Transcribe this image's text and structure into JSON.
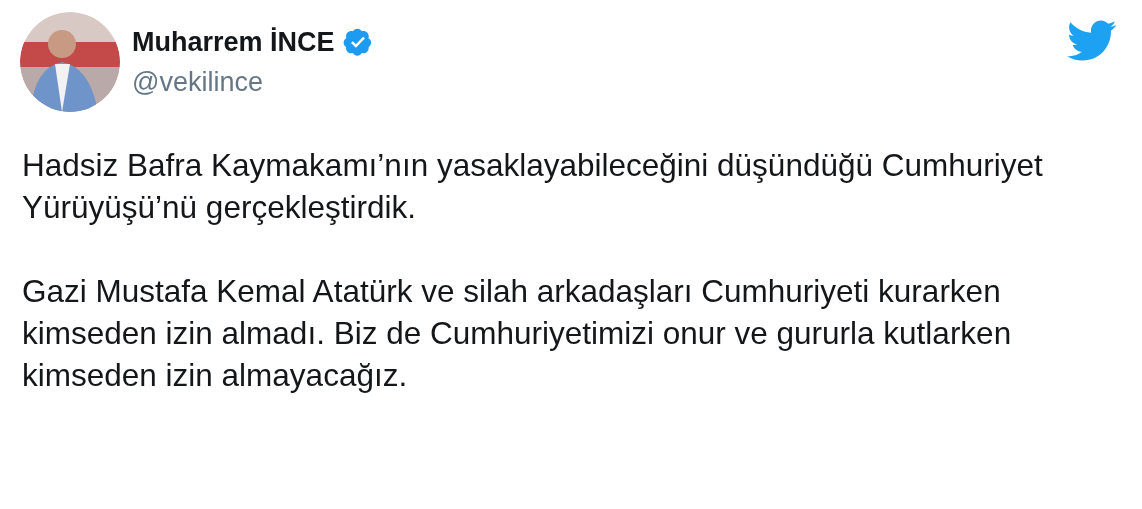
{
  "author": {
    "name": "Muharrem İNCE",
    "verified": true,
    "handle": "@vekilince"
  },
  "paragraphs": [
    "Hadsiz Bafra Kaymakamı’nın yasaklayabileceğini düşündüğü Cumhuriyet Yürüyüşü’nü gerçekleştirdik.",
    "Gazi Mustafa Kemal Atatürk ve silah arkadaşları Cumhuriyeti kurarken kimseden izin almadı. Biz de Cumhuriyetimizi onur ve gururla kutlarken kimseden izin almayacağız."
  ]
}
